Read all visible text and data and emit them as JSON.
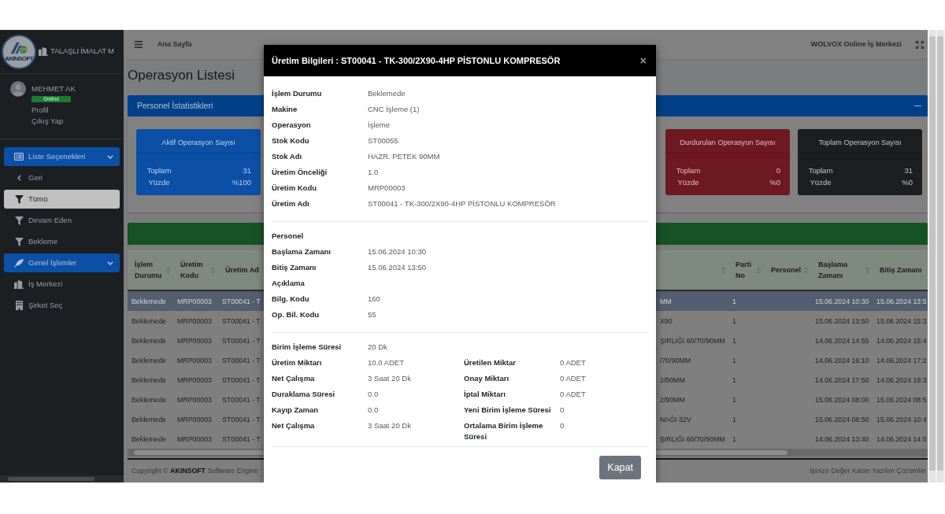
{
  "brand": {
    "logo_text": "AKINSOFT",
    "title": "TALAŞLI İMALAT M"
  },
  "user": {
    "name": "MEHMET AK",
    "status": "Online",
    "links": [
      "Profil",
      "Çıkış Yap"
    ]
  },
  "sidebar": {
    "menus": [
      {
        "label": "Liste Seçenekleri",
        "kind": "list",
        "expanded": true,
        "items": [
          {
            "label": "Geri",
            "kind": "back",
            "selected": false
          },
          {
            "label": "Tümü",
            "kind": "filter",
            "selected": true
          },
          {
            "label": "Devam Eden",
            "kind": "filter",
            "selected": false
          },
          {
            "label": "Bekleme",
            "kind": "filter",
            "selected": false
          }
        ]
      },
      {
        "label": "Genel İşlemler",
        "kind": "general",
        "expanded": true,
        "items": [
          {
            "label": "İş Merkezi",
            "kind": "workplace",
            "selected": false
          },
          {
            "label": "Şirket Seç",
            "kind": "company",
            "selected": false
          }
        ]
      }
    ]
  },
  "header": {
    "breadcrumb": "Ana Sayfa",
    "app_name": "WOLVOX Online İş Merkezi"
  },
  "page_title": "Operasyon Listesi",
  "stats_card": {
    "title": "Personel İstatistikleri"
  },
  "stats": [
    {
      "title": "Aktif Operasyon Sayısı",
      "color": "#0b50a6",
      "rows": [
        {
          "label": "Toplam",
          "value": "31"
        },
        {
          "label": "Yüzde",
          "value": "%100"
        }
      ]
    },
    {
      "title": "Durdurulan Operasyon Sayısı",
      "color": "#6e1920",
      "rows": [
        {
          "label": "Toplam",
          "value": "0"
        },
        {
          "label": "Yüzde",
          "value": "%0"
        }
      ]
    },
    {
      "title": "Toplam Operasyon Sayısı",
      "color": "#1c1f22",
      "rows": [
        {
          "label": "Toplam",
          "value": "31"
        },
        {
          "label": "Yüzde",
          "value": "%0"
        }
      ]
    }
  ],
  "table": {
    "columns": [
      {
        "label": "İşlem Durumu",
        "sortable": true
      },
      {
        "label": "Üretim Kodu",
        "sortable": true
      },
      {
        "label": "Üretim Ad",
        "sortable": false
      },
      {
        "sortable": true
      },
      {
        "label": "Parti No",
        "sortable": true
      },
      {
        "label": "Personel",
        "sortable": true
      },
      {
        "label": "Başlama Zamanı",
        "sortable": true
      },
      {
        "label": "Bitiş Zamanı",
        "sortable": false
      }
    ],
    "rows": [
      {
        "selected": true,
        "status": "Beklemede",
        "code": "MRP00003",
        "name": "ST00041 - T",
        "column_4": "MM",
        "batch": "1",
        "start": "15.06.2024 10:30",
        "end": "15.06.2024 13:5"
      },
      {
        "selected": false,
        "status": "Beklemede",
        "code": "MRP00003",
        "name": "ST00041 - T",
        "column_4": "X90",
        "batch": "1",
        "start": "15.06.2024 13:50",
        "end": "15.06.2024 15:3"
      },
      {
        "selected": false,
        "status": "Beklemede",
        "code": "MRP00003",
        "name": "ST00041 - T",
        "column_4": "ŞIRLIĞI 60/70/90MM",
        "batch": "1",
        "start": "14.06.2024 14:55",
        "end": "14.06.2024 15:4"
      },
      {
        "selected": false,
        "status": "Beklemede",
        "code": "MRP00003",
        "name": "ST00041 - T",
        "column_4": "/70/90MM",
        "batch": "1",
        "start": "14.06.2024 16:10",
        "end": "14.06.2024 17:2"
      },
      {
        "selected": false,
        "status": "Beklemede",
        "code": "MRP00003",
        "name": "ST00041 - T",
        "column_4": "2/90MM",
        "batch": "1",
        "start": "14.06.2024 17:50",
        "end": "14.06.2024 19:3"
      },
      {
        "selected": false,
        "status": "Beklemede",
        "code": "MRP00003",
        "name": "ST00041 - T",
        "column_4": "2/90MM",
        "batch": "1",
        "start": "15.06.2024 08:00",
        "end": "15.06.2024 08:5"
      },
      {
        "selected": false,
        "status": "Beklemede",
        "code": "MRP00003",
        "name": "ST00041 - T",
        "column_4": "NAĞI 32V",
        "batch": "1",
        "start": "15.06.2024 08:50",
        "end": "15.06.2024 10:4"
      },
      {
        "selected": false,
        "status": "Beklemede",
        "code": "MRP00003",
        "name": "ST00041 - T",
        "column_4": "ŞIRLIĞI 60/70/90MM",
        "batch": "1",
        "start": "14.06.2024 13:40",
        "end": "14.06.2024 14:5"
      }
    ]
  },
  "footer": {
    "copyright": "Copyright © **AKINSOFT** Software Engine",
    "tagline": "İşinize Değer Katan Yazılım Çözümler"
  },
  "modal": {
    "title": "Üretim Bilgileri : ST00041 - TK-300/2X90-4HP PİSTONLU KOMPRESÖR",
    "close": "×",
    "sections": [
      {
        "kind": "list",
        "fields": [
          {
            "label": "İşlem Durumu",
            "value": "Beklemede"
          },
          {
            "label": "Makine",
            "value": "CNC İşleme (1)"
          },
          {
            "label": "Operasyon",
            "value": "İşleme"
          },
          {
            "label": "Stok Kodu",
            "value": "ST00055"
          },
          {
            "label": "Stok Adı",
            "value": "HAZR. PETEK 90MM"
          },
          {
            "label": "Üretim Önceliği",
            "value": "1.0"
          },
          {
            "label": "Üretim Kodu",
            "value": "MRP00003"
          },
          {
            "label": "Üretim Adı",
            "value": "ST00041 - TK-300/2X90-4HP PİSTONLU KOMPRESÖR"
          }
        ]
      },
      {
        "kind": "list",
        "fields": [
          {
            "label": "Personel"
          },
          {
            "label": "Başlama Zamanı",
            "value": "15.06.2024 10:30"
          },
          {
            "label": "Bitiş Zamanı",
            "value": "15.06.2024 13:50"
          },
          {
            "label": "Açıklama"
          },
          {
            "label": "Bilg. Kodu",
            "value": "160"
          },
          {
            "label": "Op. Bil. Kodu",
            "value": "55"
          }
        ]
      },
      {
        "kind": "grid",
        "rows": [
          [
            {
              "label": "Birim İşleme Süresi",
              "value": "20 Dk"
            }
          ],
          [
            {
              "label": "Üretim Miktarı",
              "value": "10.0 ADET"
            },
            {
              "label": "Üretilen Miktar",
              "value": "0 ADET"
            }
          ],
          [
            {
              "label": "Net Çalışma",
              "value": "3 Saat 20 Dk"
            },
            {
              "label": "Onay Miktarı",
              "value": "0 ADET"
            }
          ],
          [
            {
              "label": "Duraklama Süresi",
              "value": "0.0"
            },
            {
              "label": "İptal Miktarı",
              "value": "0 ADET"
            }
          ],
          [
            {
              "label": "Kayıp Zaman",
              "value": "0.0"
            },
            {
              "label": "Yeni Birim İşleme Süresi",
              "value": "0"
            }
          ],
          [
            {
              "label": "Net Çalışma",
              "value": "3 Saat 20 Dk"
            },
            {
              "label": "Ortalama Birim İşleme Süresi",
              "value": "0"
            }
          ]
        ]
      }
    ],
    "buttons": [
      "Kapat"
    ]
  }
}
